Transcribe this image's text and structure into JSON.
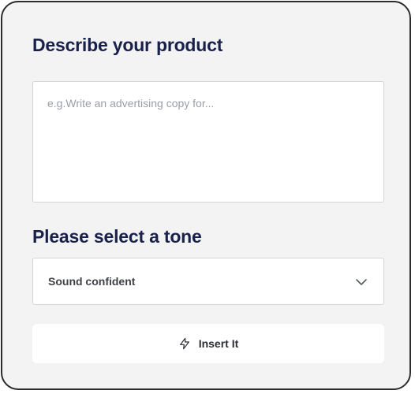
{
  "form": {
    "product_heading": "Describe your product",
    "product_input": {
      "value": "",
      "placeholder": "e.g.Write an advertising copy for..."
    },
    "tone_heading": "Please select a tone",
    "tone_select": {
      "selected": "Sound confident",
      "icon": "chevron-down-icon"
    },
    "insert_button": {
      "label": "Insert It",
      "icon": "lightning-icon"
    }
  },
  "colors": {
    "card_background": "#f3f3f4",
    "card_border": "#2c2c2c",
    "heading": "#19214a",
    "field_border": "#d2d4d9",
    "placeholder": "#9a9ea8"
  }
}
